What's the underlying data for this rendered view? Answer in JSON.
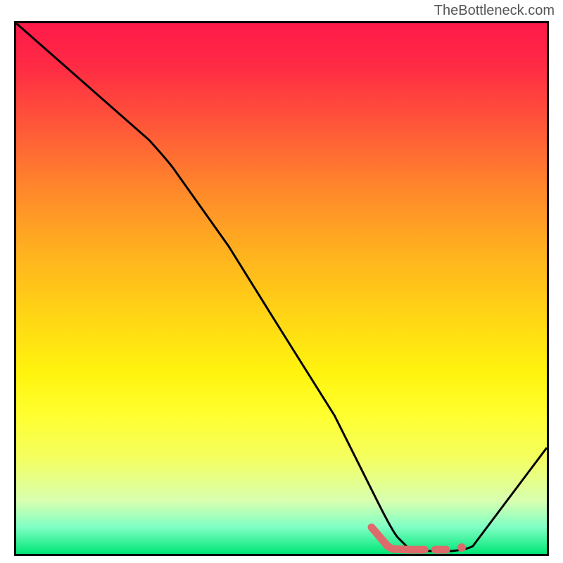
{
  "watermark": "TheBottleneck.com",
  "chart_data": {
    "type": "line",
    "title": "",
    "xlabel": "",
    "ylabel": "",
    "xlim": [
      0,
      100
    ],
    "ylim": [
      0,
      100
    ],
    "series": [
      {
        "name": "main-curve",
        "color": "#000000",
        "x": [
          0,
          25,
          30,
          40,
          50,
          60,
          68,
          72,
          74,
          78,
          82,
          86,
          100
        ],
        "y": [
          100,
          78,
          74,
          58,
          42,
          26,
          10,
          3,
          1,
          0.5,
          0.5,
          1.5,
          20
        ]
      },
      {
        "name": "highlight-segment-1",
        "color": "#e07070",
        "style": "thick",
        "x": [
          67,
          70,
          71,
          74,
          77
        ],
        "y": [
          5,
          1.5,
          1,
          0.8,
          0.8
        ]
      },
      {
        "name": "highlight-segment-2",
        "color": "#e07070",
        "style": "thick-short",
        "x": [
          79,
          81
        ],
        "y": [
          0.8,
          0.8
        ]
      },
      {
        "name": "highlight-dot",
        "color": "#e07070",
        "style": "dot",
        "x": [
          84
        ],
        "y": [
          1.2
        ]
      }
    ],
    "gradient_stops": [
      {
        "pos": 0,
        "color": "#ff1a4a"
      },
      {
        "pos": 8,
        "color": "#ff2a44"
      },
      {
        "pos": 20,
        "color": "#ff5a38"
      },
      {
        "pos": 32,
        "color": "#ff8a2a"
      },
      {
        "pos": 44,
        "color": "#ffb41e"
      },
      {
        "pos": 56,
        "color": "#ffd814"
      },
      {
        "pos": 66,
        "color": "#fff40e"
      },
      {
        "pos": 74,
        "color": "#ffff30"
      },
      {
        "pos": 82,
        "color": "#f4ff60"
      },
      {
        "pos": 90,
        "color": "#d8ffb0"
      },
      {
        "pos": 95,
        "color": "#7effc4"
      },
      {
        "pos": 100,
        "color": "#00e676"
      }
    ]
  }
}
